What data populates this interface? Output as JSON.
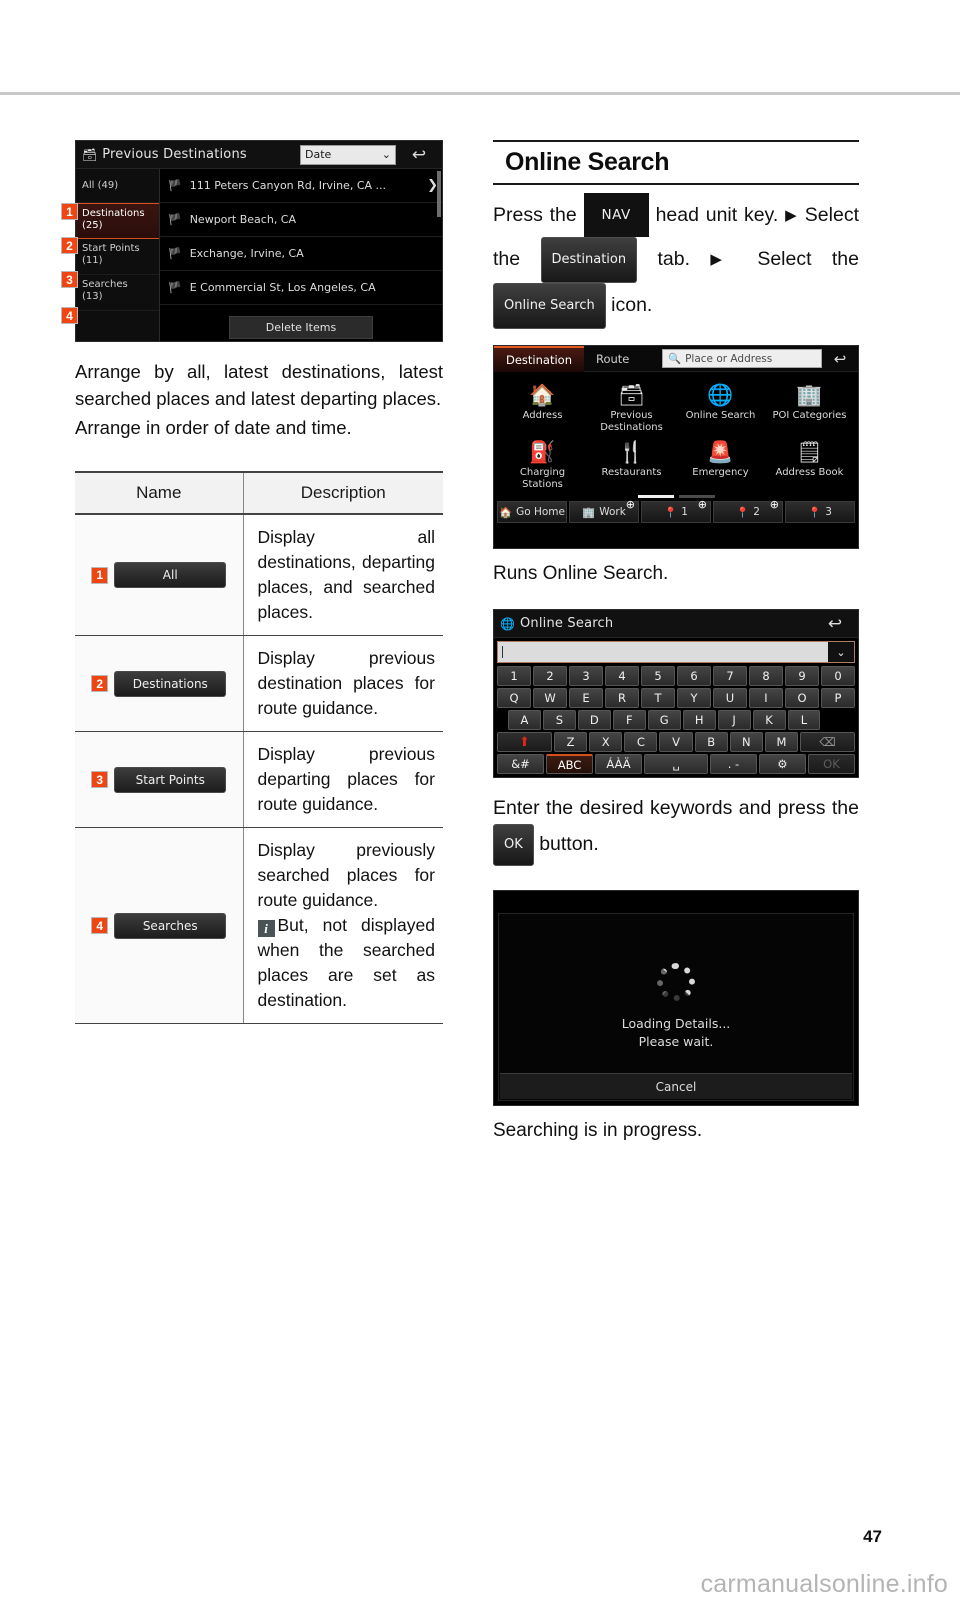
{
  "page": {
    "number": "47",
    "watermark": "carmanualsonline.info"
  },
  "left": {
    "prev_dest_screen": {
      "title": "Previous Destinations",
      "folder_icon": "folder-clock-icon",
      "sort_value": "Date",
      "back_icon": "back-arrow-icon",
      "side_items": [
        {
          "num": "1",
          "label": "All (49)",
          "line1": "All (49)",
          "line2": ""
        },
        {
          "num": "2",
          "label": "Destinations (25)",
          "line1": "Destinations",
          "line2": "(25)"
        },
        {
          "num": "3",
          "label": "Start Points (11)",
          "line1": "Start Points",
          "line2": "(11)"
        },
        {
          "num": "4",
          "label": "Searches (13)",
          "line1": "Searches",
          "line2": "(13)"
        }
      ],
      "rows": [
        "111 Peters Canyon Rd, Irvine, CA ...",
        "Newport Beach, CA",
        "Exchange, Irvine, CA",
        "E Commercial St, Los Angeles, CA"
      ],
      "delete_label": "Delete Items"
    },
    "paragraph1": "Arrange by all, latest destinations, latest searched places and latest departing places.",
    "paragraph2": "Arrange in order of date and time.",
    "table": {
      "headers": [
        "Name",
        "Description"
      ],
      "rows": [
        {
          "num": "1",
          "button": "All",
          "description": "Display all destinations, departing places, and searched places.",
          "note": ""
        },
        {
          "num": "2",
          "button": "Destinations",
          "description": "Display previous destination places for route guidance.",
          "note": ""
        },
        {
          "num": "3",
          "button": "Start Points",
          "description": "Display previous departing places for route guidance.",
          "note": ""
        },
        {
          "num": "4",
          "button": "Searches",
          "description": "Display previously searched places for route guidance.",
          "note": "But, not displayed when the searched places are set as destination."
        }
      ]
    }
  },
  "right": {
    "heading": "Online Search",
    "steps": {
      "part1": "Press the",
      "key_nav": "NAV",
      "part2": "head unit key.",
      "part3": "Select the",
      "key_destination": "Destination",
      "part4": "tab.",
      "part5": "Select the",
      "key_online_search": "Online Search",
      "part6": "icon.",
      "arrow": "▶"
    },
    "dest_screen": {
      "tabs": [
        "Destination",
        "Route"
      ],
      "search_placeholder": "Place or Address",
      "search_icon": "magnifier-icon",
      "back_icon": "back-arrow-icon",
      "grid": [
        {
          "label": "Address",
          "icon": "home-search-icon"
        },
        {
          "label": "Previous Destinations",
          "icon": "folder-clock-icon"
        },
        {
          "label": "Online Search",
          "icon": "globe-search-icon"
        },
        {
          "label": "POI Categories",
          "icon": "building-search-icon"
        },
        {
          "label": "Charging Stations",
          "icon": "charging-station-icon"
        },
        {
          "label": "Restaurants",
          "icon": "fork-knife-icon"
        },
        {
          "label": "Emergency",
          "icon": "emergency-light-icon"
        },
        {
          "label": "Address Book",
          "icon": "address-book-icon"
        }
      ],
      "shortcuts": [
        {
          "label": "Go Home",
          "icon": "home-icon",
          "plus": false
        },
        {
          "label": "Work",
          "icon": "office-icon",
          "plus": true
        },
        {
          "label": "1",
          "icon": "pin-icon",
          "plus": true
        },
        {
          "label": "2",
          "icon": "pin-icon",
          "plus": true
        },
        {
          "label": "3",
          "icon": "pin-icon",
          "plus": false
        }
      ]
    },
    "caption1": "Runs Online Search.",
    "keyboard_screen": {
      "title": "Online Search",
      "title_icon": "globe-search-icon",
      "back_icon": "back-arrow-icon",
      "input_value": "",
      "dropdown_icon": "chevron-down-icon",
      "row_numbers": [
        "1",
        "2",
        "3",
        "4",
        "5",
        "6",
        "7",
        "8",
        "9",
        "0"
      ],
      "row_top": [
        "Q",
        "W",
        "E",
        "R",
        "T",
        "Y",
        "U",
        "I",
        "O",
        "P"
      ],
      "row_home": [
        "A",
        "S",
        "D",
        "F",
        "G",
        "H",
        "J",
        "K",
        "L"
      ],
      "row_bottom": [
        "Z",
        "X",
        "C",
        "V",
        "B",
        "N",
        "M"
      ],
      "shift_icon": "shift-up-arrow-icon",
      "backspace_icon": "backspace-icon",
      "fn_row": [
        "&#",
        "ABC",
        "ÁÀÄ",
        "␣",
        ". -",
        "⚙",
        "OK"
      ],
      "fn_active_index": 1
    },
    "instruction": {
      "part1": "Enter the desired keywords and press the",
      "key_ok": "OK",
      "part2": "button."
    },
    "loading_screen": {
      "line1": "Loading Details...",
      "line2": "Please wait.",
      "cancel": "Cancel",
      "spinner_icon": "loading-spinner-icon"
    },
    "caption2": "Searching is in progress."
  }
}
